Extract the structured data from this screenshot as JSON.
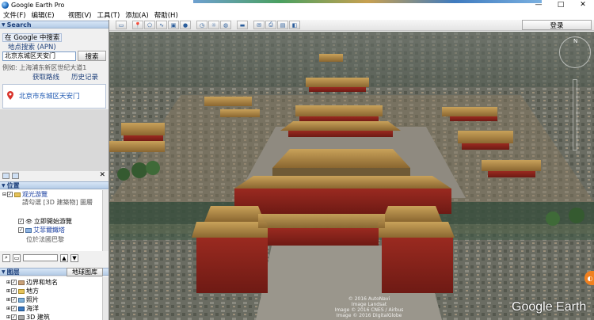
{
  "window": {
    "title": "Google Earth Pro",
    "minimize": "—",
    "maximize": "□",
    "close": "✕"
  },
  "menu": {
    "items": [
      {
        "label": "文件(F)"
      },
      {
        "label": "编辑(E)"
      },
      {
        "label": "视图(V)"
      },
      {
        "label": "工具(T)"
      },
      {
        "label": "添加(A)"
      },
      {
        "label": "帮助(H)"
      }
    ]
  },
  "toolbar": {
    "login_label": "登录"
  },
  "search": {
    "header": "Search",
    "tab_google": "在 Google 中搜索",
    "tab_local": "地点搜索 (APN)",
    "input_value": "北京东城区天安门",
    "button_label": "搜索",
    "example": "例如: 上海浦东新区世纪大道1",
    "link_route": "获取路线",
    "link_history": "历史记录",
    "result": "北京市东城区天安门"
  },
  "places": {
    "header": "位置",
    "items": [
      {
        "label": "观光游覽",
        "checked": "✓"
      },
      {
        "label": "請勾選 [3D 建築物] 圖層"
      },
      {
        "label": "立即開始游覽",
        "checked": "✓"
      },
      {
        "label": "艾菲爾鐵塔",
        "checked": "✓"
      },
      {
        "label": "位於法國巴黎"
      }
    ]
  },
  "layers": {
    "header": "图层",
    "gallery_button": "地球图库",
    "items": [
      {
        "label": "边界和地名",
        "checked": "✓"
      },
      {
        "label": "地方",
        "checked": "✓"
      },
      {
        "label": "照片",
        "checked": "✓"
      },
      {
        "label": "海洋",
        "checked": "✓"
      },
      {
        "label": "3D 建筑",
        "checked": "✓"
      }
    ]
  },
  "map": {
    "attribution": [
      "© 2016 AutoNavi",
      "Image Landsat",
      "Image © 2016 CNES / Airbus",
      "Image © 2016 DigitalGlobe"
    ],
    "logo": "Google Earth",
    "compass_n": "N"
  }
}
